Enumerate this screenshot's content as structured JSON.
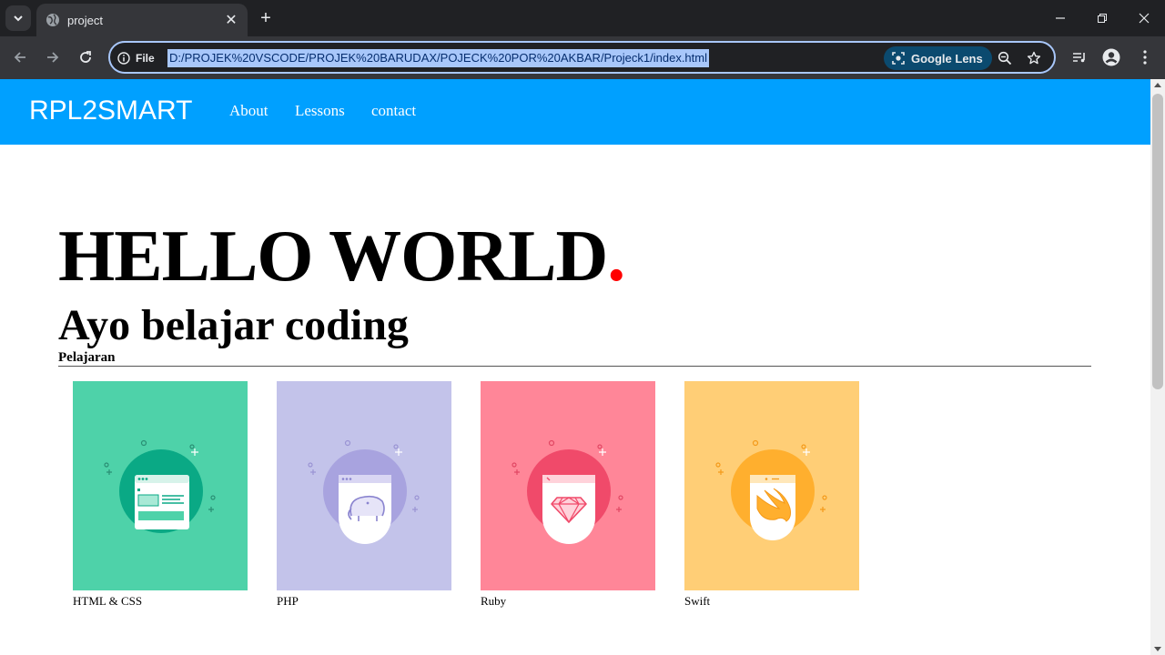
{
  "browser": {
    "tab_title": "project",
    "site_info": "File",
    "url": "D:/PROJEK%20VSCODE/PROJEK%20BARUDAX/POJECK%20POR%20AKBAR/Projeck1/index.html",
    "lens_label": "Google Lens"
  },
  "site": {
    "brand": "RPL2SMART",
    "nav": [
      "About",
      "Lessons",
      "contact"
    ],
    "hero_title": "HELLO WORLD",
    "hero_dot": ".",
    "subtitle": "Ayo belajar coding",
    "section_label": "Pelajaran",
    "cards": [
      {
        "caption": "HTML & CSS",
        "bg": "#4ed2a9",
        "circle": "#0aa985",
        "icon": "browser-window-icon"
      },
      {
        "caption": "PHP",
        "bg": "#c3c3ea",
        "circle": "#a8a3df",
        "icon": "elephant-icon"
      },
      {
        "caption": "Ruby",
        "bg": "#ff8698",
        "circle": "#f04a6a",
        "icon": "ruby-gem-icon"
      },
      {
        "caption": "Swift",
        "bg": "#ffce76",
        "circle": "#ffaf2e",
        "icon": "swift-bird-icon"
      }
    ]
  },
  "colors": {
    "nav_bg": "#00a0ff",
    "hero_dot": "#ff0000"
  }
}
